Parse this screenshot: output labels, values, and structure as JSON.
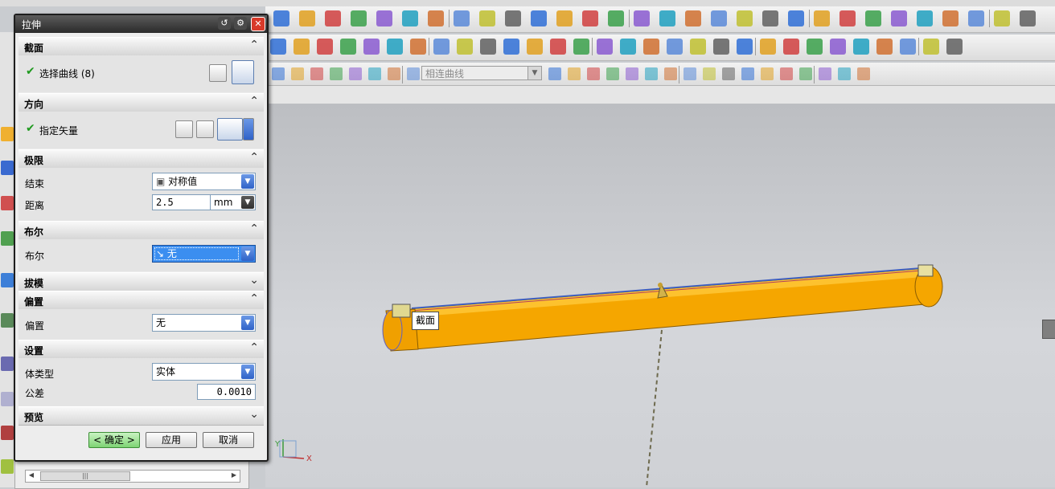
{
  "dialog": {
    "title": "拉伸",
    "sections": {
      "section": {
        "header": "截面",
        "select_curve": "选择曲线 (8)"
      },
      "direction": {
        "header": "方向",
        "specify_vector": "指定矢量"
      },
      "limits": {
        "header": "极限",
        "end_label": "结束",
        "end_value": "对称值",
        "distance_label": "距离",
        "distance_value": "2.5",
        "distance_unit": "mm"
      },
      "boolean": {
        "header": "布尔",
        "boolean_label": "布尔",
        "boolean_value": "无"
      },
      "draft": {
        "header": "拔模"
      },
      "offset": {
        "header": "偏置",
        "offset_label": "偏置",
        "offset_value": "无"
      },
      "settings": {
        "header": "设置",
        "body_type_label": "体类型",
        "body_type_value": "实体",
        "tolerance_label": "公差",
        "tolerance_value": "0.0010"
      },
      "preview": {
        "header": "预览"
      }
    },
    "buttons": {
      "ok": "< 确定 >",
      "apply": "应用",
      "cancel": "取消"
    }
  },
  "toolbar": {
    "filter_combo": "相连曲线"
  },
  "viewport": {
    "tooltip": "截面",
    "triad": {
      "x_label": "X",
      "y_label": "Y"
    }
  },
  "colors": {
    "model_fill": "#f5a600",
    "model_edge": "#3f5fbf",
    "title_bar": "#2e2e2e",
    "ok_button": "#8ed884",
    "selection": "#3b8ef0"
  },
  "icons": [
    "undo-icon",
    "gear-icon",
    "close-icon",
    "chevron-up-icon",
    "chevron-down-icon",
    "check-icon",
    "curve-rule-icon",
    "section-select-icon",
    "reverse-direction-icon",
    "vector-dialog-icon",
    "infer-vector-icon",
    "dropdown-arrow-icon",
    "symmetric-value-icon",
    "boolean-none-icon"
  ]
}
